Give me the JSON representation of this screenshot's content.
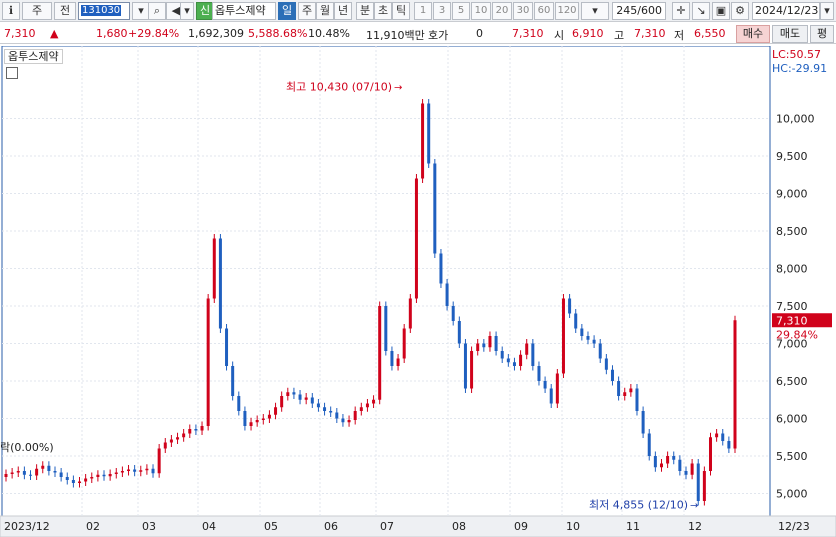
{
  "toolbar": {
    "buttons": [
      {
        "name": "period-prev-button",
        "label": "ℹ"
      },
      {
        "name": "type-stock-button",
        "label": "주"
      },
      {
        "name": "market-all-button",
        "label": "전"
      }
    ],
    "code": "131030",
    "search_icon": "search-icon",
    "sound_icon": "speaker-icon",
    "new_label": "신",
    "stock_name": "옵투스제약",
    "period_tabs": [
      "일",
      "주",
      "월",
      "년",
      "분",
      "초",
      "틱"
    ],
    "minute_values": [
      "1",
      "3",
      "5",
      "10",
      "20",
      "30",
      "60",
      "120"
    ],
    "count": "245/600",
    "date": "2024/12/23"
  },
  "quote": {
    "price": "7,310",
    "change": "1,680",
    "change_pct": "+29.84%",
    "volume": "1,692,309",
    "volume_pct": "5,588.68%",
    "turnover": "10.48%",
    "amount": "11,910백만",
    "hoga_label": "호가",
    "hoga_value": "0",
    "ask_price": "7,310",
    "open_label": "시",
    "open": "6,910",
    "high_label": "고",
    "high": "7,310",
    "low_label": "저",
    "low": "6,550",
    "buy_label": "매수",
    "sell_label": "매도",
    "avg_label": "평"
  },
  "chart_data": {
    "type": "candlestick",
    "title": "옵투스제약",
    "ylim": [
      4700,
      10700
    ],
    "yticks": [
      5000,
      5500,
      6000,
      6500,
      7000,
      7500,
      8000,
      8500,
      9000,
      9500,
      10000
    ],
    "ytick_labels": [
      "5,000",
      "5,500",
      "6,000",
      "6,500",
      "7,000",
      "7,500",
      "8,000",
      "8,500",
      "9,000",
      "9,500",
      "10,000"
    ],
    "x_labels": [
      "2023/12",
      "02",
      "03",
      "04",
      "05",
      "06",
      "07",
      "08",
      "09",
      "10",
      "11",
      "12",
      "12/23"
    ],
    "series_close": [
      5260,
      5280,
      5300,
      5250,
      5240,
      5330,
      5370,
      5300,
      5280,
      5220,
      5180,
      5140,
      5160,
      5200,
      5220,
      5250,
      5230,
      5260,
      5280,
      5300,
      5320,
      5290,
      5310,
      5330,
      5270,
      5600,
      5680,
      5720,
      5750,
      5800,
      5860,
      5840,
      5900,
      7600,
      8400,
      7200,
      6700,
      6300,
      6100,
      5900,
      5950,
      5980,
      6000,
      6050,
      6150,
      6300,
      6350,
      6320,
      6250,
      6280,
      6200,
      6150,
      6100,
      6080,
      6000,
      5950,
      5980,
      6100,
      6150,
      6200,
      6250,
      7500,
      6900,
      6700,
      6800,
      7200,
      7600,
      9200,
      10200,
      9400,
      8200,
      7800,
      7500,
      7300,
      7000,
      6400,
      6900,
      7000,
      6950,
      7100,
      6900,
      6800,
      6750,
      6700,
      6850,
      7000,
      6700,
      6500,
      6400,
      6200,
      6600,
      7600,
      7400,
      7200,
      7100,
      7050,
      7000,
      6800,
      6650,
      6500,
      6300,
      6350,
      6400,
      6100,
      5800,
      5500,
      5350,
      5400,
      5500,
      5450,
      5300,
      5250,
      5400,
      4900,
      5300,
      5750,
      5800,
      5700,
      5600,
      7310
    ],
    "annotations": {
      "high": "최고 10,430 (07/10)",
      "low": "최저 4,855 (12/10)",
      "base": "락(0.00%)",
      "lc": "LC:50.57",
      "hc": "HC:-29.91",
      "last_price": "7,310",
      "last_pct": "29.84%"
    },
    "colors": {
      "up": "#d0021b",
      "down": "#1f5fbf",
      "grid": "#e1e6ee",
      "axis": "#2a5ca8"
    }
  }
}
